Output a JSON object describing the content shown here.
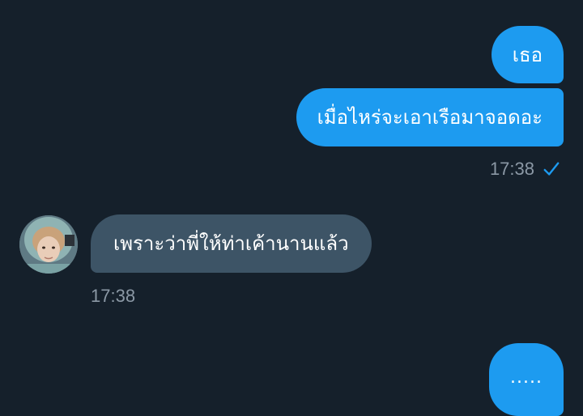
{
  "messages": [
    {
      "direction": "outgoing",
      "text": "เธอ"
    },
    {
      "direction": "outgoing",
      "text": "เมื่อไหร่จะเอาเรือมาจอดอะ"
    },
    {
      "direction": "incoming",
      "text": "เพราะว่าพี่ให้ท่าเค้านานแล้ว"
    },
    {
      "direction": "outgoing",
      "text": "....."
    }
  ],
  "timestamps": {
    "outgoing": "17:38",
    "incoming": "17:38"
  },
  "status": {
    "read_icon": "check-icon"
  },
  "colors": {
    "background": "#15202b",
    "outgoing_bubble": "#1d9bf0",
    "incoming_bubble": "#3d5466",
    "timestamp": "#8b98a5",
    "check": "#1d9bf0"
  }
}
